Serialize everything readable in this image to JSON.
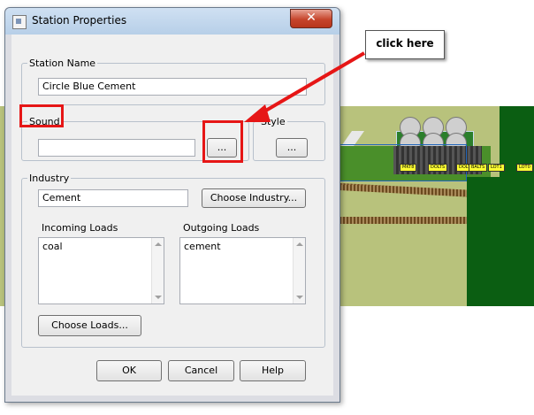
{
  "dialog": {
    "title": "Station Properties",
    "close_label": "✕",
    "station_name": {
      "legend": "Station Name",
      "value": "Circle Blue Cement"
    },
    "sound": {
      "legend": "Sound",
      "value": "",
      "browse_label": "..."
    },
    "style": {
      "legend": "Style",
      "browse_label": "..."
    },
    "industry": {
      "legend": "Industry",
      "value": "Cement",
      "choose_label": "Choose Industry...",
      "incoming_label": "Incoming Loads",
      "incoming_items": [
        "coal"
      ],
      "outgoing_label": "Outgoing Loads",
      "outgoing_items": [
        "cement"
      ],
      "choose_loads_label": "Choose Loads..."
    },
    "buttons": {
      "ok": "OK",
      "cancel": "Cancel",
      "help": "Help"
    }
  },
  "annotation": {
    "callout_text": "click here",
    "color": "#e61616"
  },
  "map": {
    "labels": [
      "MKT8",
      "DOLTS",
      "DOLTS",
      "BALTS",
      "LOT1",
      "LOT0"
    ]
  }
}
